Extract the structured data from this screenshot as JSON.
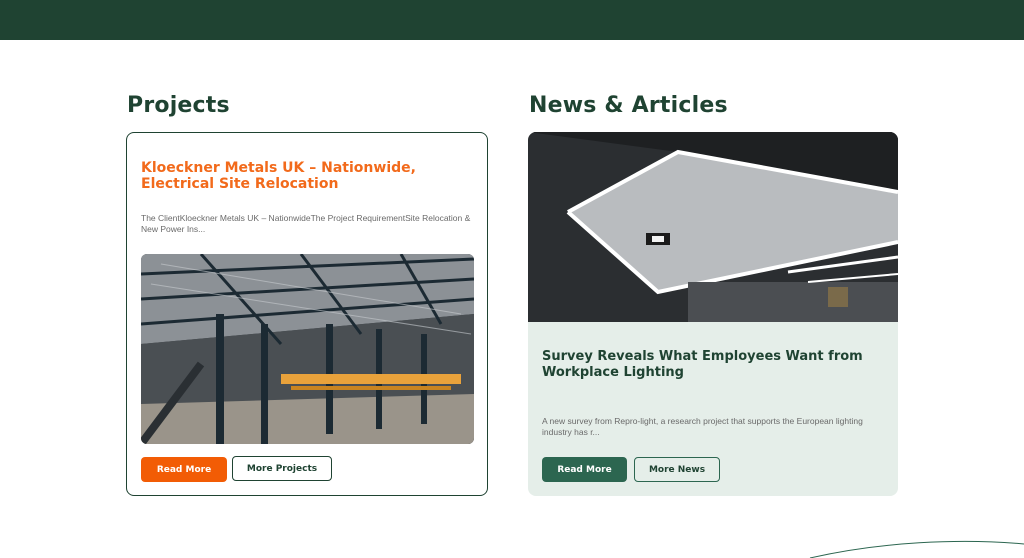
{
  "projects": {
    "title": "Projects",
    "card": {
      "heading": "Kloeckner Metals UK – Nationwide, Electrical Site Relocation",
      "excerpt": "The ClientKloeckner Metals UK – NationwideThe Project RequirementSite Relocation & New Power Ins...",
      "read_more_label": "Read More",
      "more_label": "More Projects"
    }
  },
  "news": {
    "title": "News & Articles",
    "card": {
      "heading": "Survey Reveals What Employees Want from Workplace Lighting",
      "excerpt": "A new survey from Repro-light, a research project that supports the European lighting industry has r...",
      "read_more_label": "Read More",
      "more_label": "More News"
    }
  },
  "colors": {
    "brand_dark_green": "#1f4332",
    "accent_orange": "#f25c05",
    "button_green": "#2c6650",
    "news_card_bg": "#e5eee9"
  }
}
